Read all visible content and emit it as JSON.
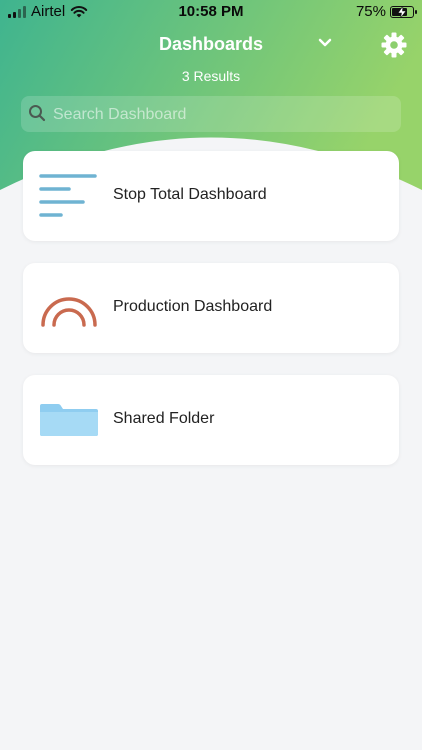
{
  "status_bar": {
    "carrier": "Airtel",
    "time": "10:58 PM",
    "battery": "75%",
    "battery_level": 0.75,
    "icons": [
      "signal-icon",
      "wifi-icon",
      "battery-icon"
    ]
  },
  "header": {
    "title": "Dashboards",
    "results": "3 Results",
    "gradient_from": "#3fb48f",
    "gradient_to": "#97d36a",
    "icons": [
      "chevron-down-icon",
      "gear-icon"
    ]
  },
  "search": {
    "placeholder": "Search Dashboard",
    "value": ""
  },
  "items": [
    {
      "label": "Stop Total Dashboard",
      "icon": "bar-list-icon",
      "color": "#6fb3d2"
    },
    {
      "label": "Production Dashboard",
      "icon": "gauge-arc-icon",
      "color": "#c96a4f"
    },
    {
      "label": "Shared Folder",
      "icon": "folder-icon",
      "color": "#8fcdf0"
    }
  ],
  "colors": {
    "background": "#f4f5f7",
    "card": "#ffffff"
  }
}
